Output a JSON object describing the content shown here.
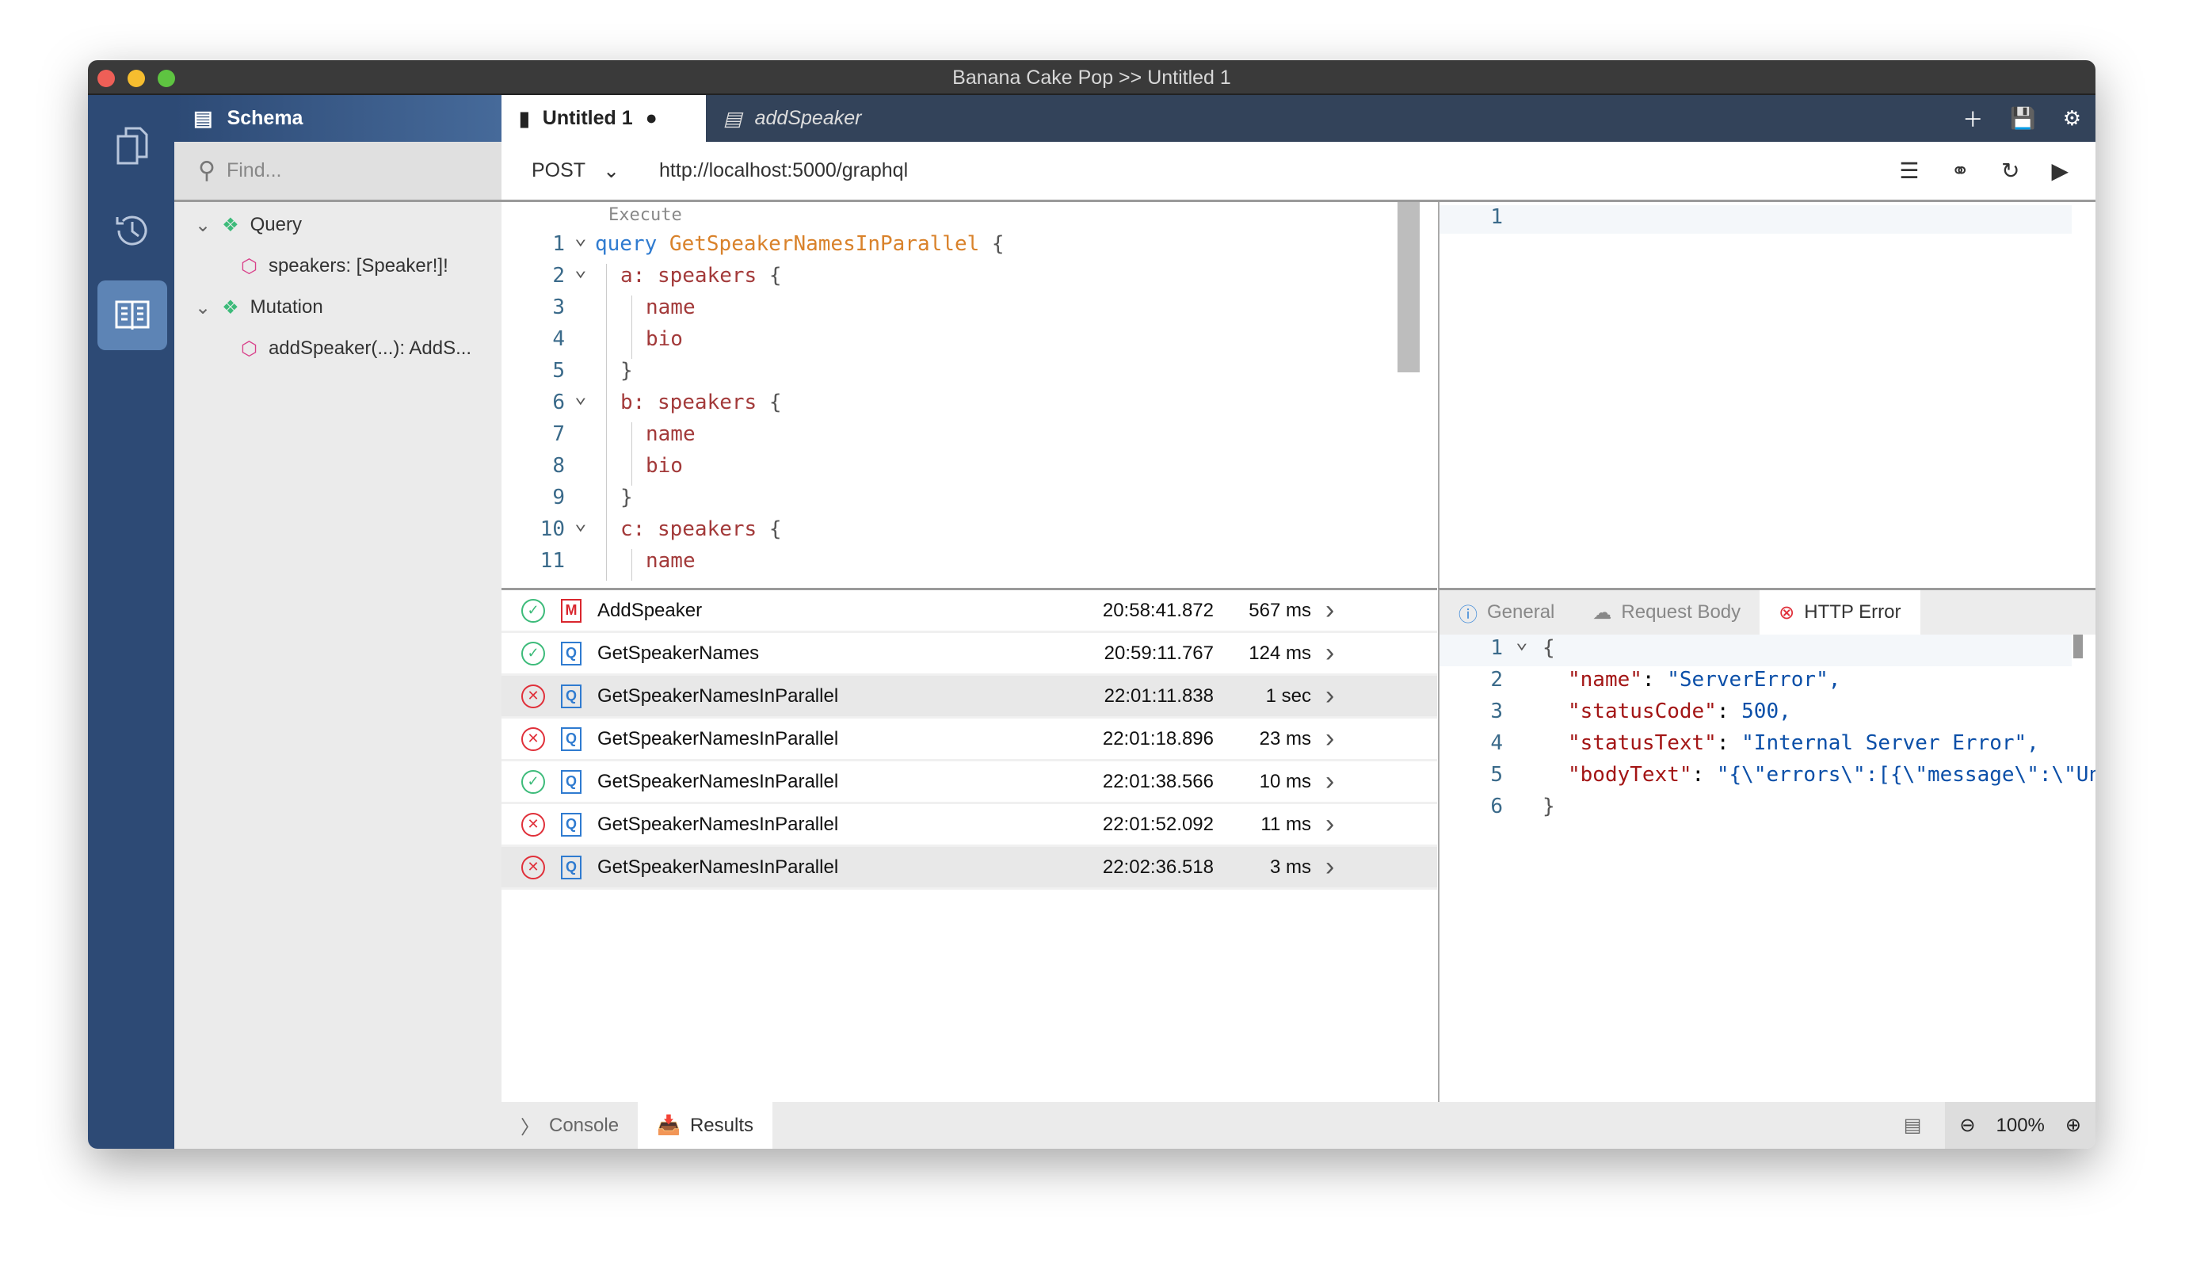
{
  "window": {
    "title": "Banana Cake Pop >> Untitled 1"
  },
  "nav": {
    "items": [
      {
        "icon": "documents-icon"
      },
      {
        "icon": "history-icon"
      },
      {
        "icon": "schema-book-icon",
        "active": true
      }
    ]
  },
  "schema": {
    "title": "Schema",
    "find_placeholder": "Find...",
    "tree": [
      {
        "label": "Query",
        "children": [
          "speakers: [Speaker!]!"
        ]
      },
      {
        "label": "Mutation",
        "children": [
          "addSpeaker(...): AddS..."
        ]
      }
    ]
  },
  "tabs": [
    {
      "label": "Untitled 1",
      "unsaved": true,
      "active": true
    },
    {
      "label": "addSpeaker",
      "active": false
    }
  ],
  "toolbar": {
    "icons": [
      "plus-icon",
      "save-icon",
      "gear-icon"
    ]
  },
  "request": {
    "method": "POST",
    "url": "http://localhost:5000/graphql"
  },
  "editor": {
    "execute_label": "Execute",
    "lines": [
      {
        "n": "1",
        "fold": true,
        "indent": 0,
        "parts": [
          [
            "kw",
            "query "
          ],
          [
            "fn",
            "GetSpeakerNamesInParallel"
          ],
          [
            "br",
            " {"
          ]
        ]
      },
      {
        "n": "2",
        "fold": true,
        "indent": 1,
        "parts": [
          [
            "fld",
            "a: speakers"
          ],
          [
            "br",
            " {"
          ]
        ]
      },
      {
        "n": "3",
        "indent": 2,
        "parts": [
          [
            "fld",
            "name"
          ]
        ]
      },
      {
        "n": "4",
        "indent": 2,
        "parts": [
          [
            "fld",
            "bio"
          ]
        ]
      },
      {
        "n": "5",
        "indent": 1,
        "parts": [
          [
            "br",
            "}"
          ]
        ]
      },
      {
        "n": "6",
        "fold": true,
        "indent": 1,
        "parts": [
          [
            "fld",
            "b: speakers"
          ],
          [
            "br",
            " {"
          ]
        ]
      },
      {
        "n": "7",
        "indent": 2,
        "parts": [
          [
            "fld",
            "name"
          ]
        ]
      },
      {
        "n": "8",
        "indent": 2,
        "parts": [
          [
            "fld",
            "bio"
          ]
        ]
      },
      {
        "n": "9",
        "indent": 1,
        "parts": [
          [
            "br",
            "}"
          ]
        ]
      },
      {
        "n": "10",
        "fold": true,
        "indent": 1,
        "parts": [
          [
            "fld",
            "c: speakers"
          ],
          [
            "br",
            " {"
          ]
        ]
      },
      {
        "n": "11",
        "indent": 2,
        "parts": [
          [
            "fld",
            "name"
          ]
        ]
      }
    ]
  },
  "variables": {
    "lines": [
      "1"
    ]
  },
  "history": [
    {
      "status": "success",
      "type": "M",
      "name": "AddSpeaker",
      "time": "20:58:41.872",
      "duration": "567 ms"
    },
    {
      "status": "success",
      "type": "Q",
      "name": "GetSpeakerNames",
      "time": "20:59:11.767",
      "duration": "124 ms"
    },
    {
      "status": "error",
      "type": "Q",
      "name": "GetSpeakerNamesInParallel",
      "time": "22:01:11.838",
      "duration": "1 sec",
      "selected": true
    },
    {
      "status": "error",
      "type": "Q",
      "name": "GetSpeakerNamesInParallel",
      "time": "22:01:18.896",
      "duration": "23 ms"
    },
    {
      "status": "success",
      "type": "Q",
      "name": "GetSpeakerNamesInParallel",
      "time": "22:01:38.566",
      "duration": "10 ms"
    },
    {
      "status": "error",
      "type": "Q",
      "name": "GetSpeakerNamesInParallel",
      "time": "22:01:52.092",
      "duration": "11 ms"
    },
    {
      "status": "error",
      "type": "Q",
      "name": "GetSpeakerNamesInParallel",
      "time": "22:02:36.518",
      "duration": "3 ms",
      "selected": true
    }
  ],
  "response_tabs": [
    {
      "label": "General"
    },
    {
      "label": "Request Body"
    },
    {
      "label": "HTTP Error",
      "active": true
    }
  ],
  "response_json": [
    {
      "n": "1",
      "text": "{",
      "fold": true
    },
    {
      "n": "2",
      "key": "\"name\"",
      "val": "\"ServerError\","
    },
    {
      "n": "3",
      "key": "\"statusCode\"",
      "val": "500,"
    },
    {
      "n": "4",
      "key": "\"statusText\"",
      "val": "\"Internal Server Error\","
    },
    {
      "n": "5",
      "key": "\"bodyText\"",
      "val": "\"{\\\"errors\\\":[{\\\"message\\\":\\\"Unexpected"
    },
    {
      "n": "6",
      "text": "}"
    }
  ],
  "bottom": {
    "tabs": [
      {
        "label": "Console"
      },
      {
        "label": "Results",
        "active": true
      }
    ],
    "zoom": "100%"
  },
  "colors": {
    "nav": "#2d4a75",
    "tabbar": "#33435a",
    "success": "#3dbb7a",
    "error": "#e0303a",
    "query": "#2f7bd0",
    "mutation": "#d9262e"
  }
}
